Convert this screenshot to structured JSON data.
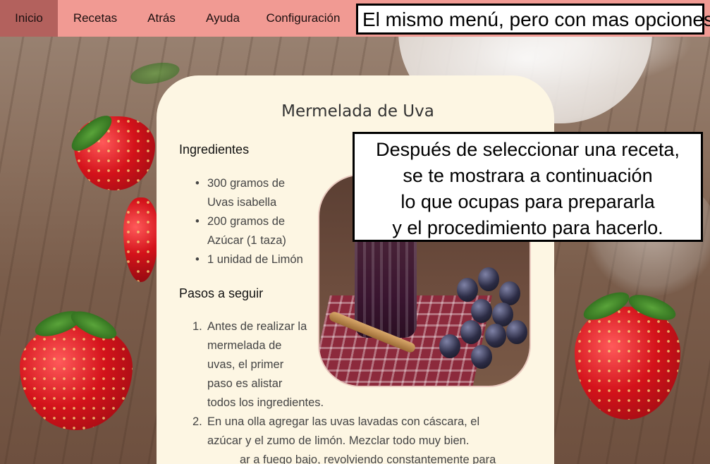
{
  "nav": {
    "items": [
      {
        "label": "Inicio",
        "active": true
      },
      {
        "label": "Recetas",
        "active": false
      },
      {
        "label": "Atrás",
        "active": false
      },
      {
        "label": "Ayuda",
        "active": false
      },
      {
        "label": "Configuración",
        "active": false
      }
    ]
  },
  "annotations": {
    "menu": "El mismo menú, pero con mas opciones.",
    "recipe_lines": [
      "Después de seleccionar una receta,",
      "se te mostrara a continuación",
      "lo que ocupas para prepararla",
      "y el procedimiento para hacerlo."
    ]
  },
  "recipe": {
    "title": "Mermelada de Uva",
    "ingredients_heading": "Ingredientes",
    "ingredients": [
      [
        "300 gramos de",
        "Uvas isabella"
      ],
      [
        "200 gramos de",
        "Azúcar (1 taza)"
      ],
      [
        "1 unidad de Limón"
      ]
    ],
    "steps_heading": "Pasos a seguir",
    "steps": [
      {
        "num": "1.",
        "lines": [
          "Antes de realizar la",
          "mermelada de",
          "uvas, el primer",
          "paso es alistar",
          "todos los ingredientes."
        ]
      },
      {
        "num": "2.",
        "lines": [
          "En una olla agregar las uvas lavadas con cáscara, el",
          "azúcar y el zumo de limón. Mezclar todo muy bien.",
          "ar a fuego bajo, revolviendo constantemente para"
        ]
      }
    ]
  },
  "colors": {
    "nav_bg": "#f19a93",
    "nav_active": "#b3615d",
    "card_bg": "#fdf6e3"
  }
}
